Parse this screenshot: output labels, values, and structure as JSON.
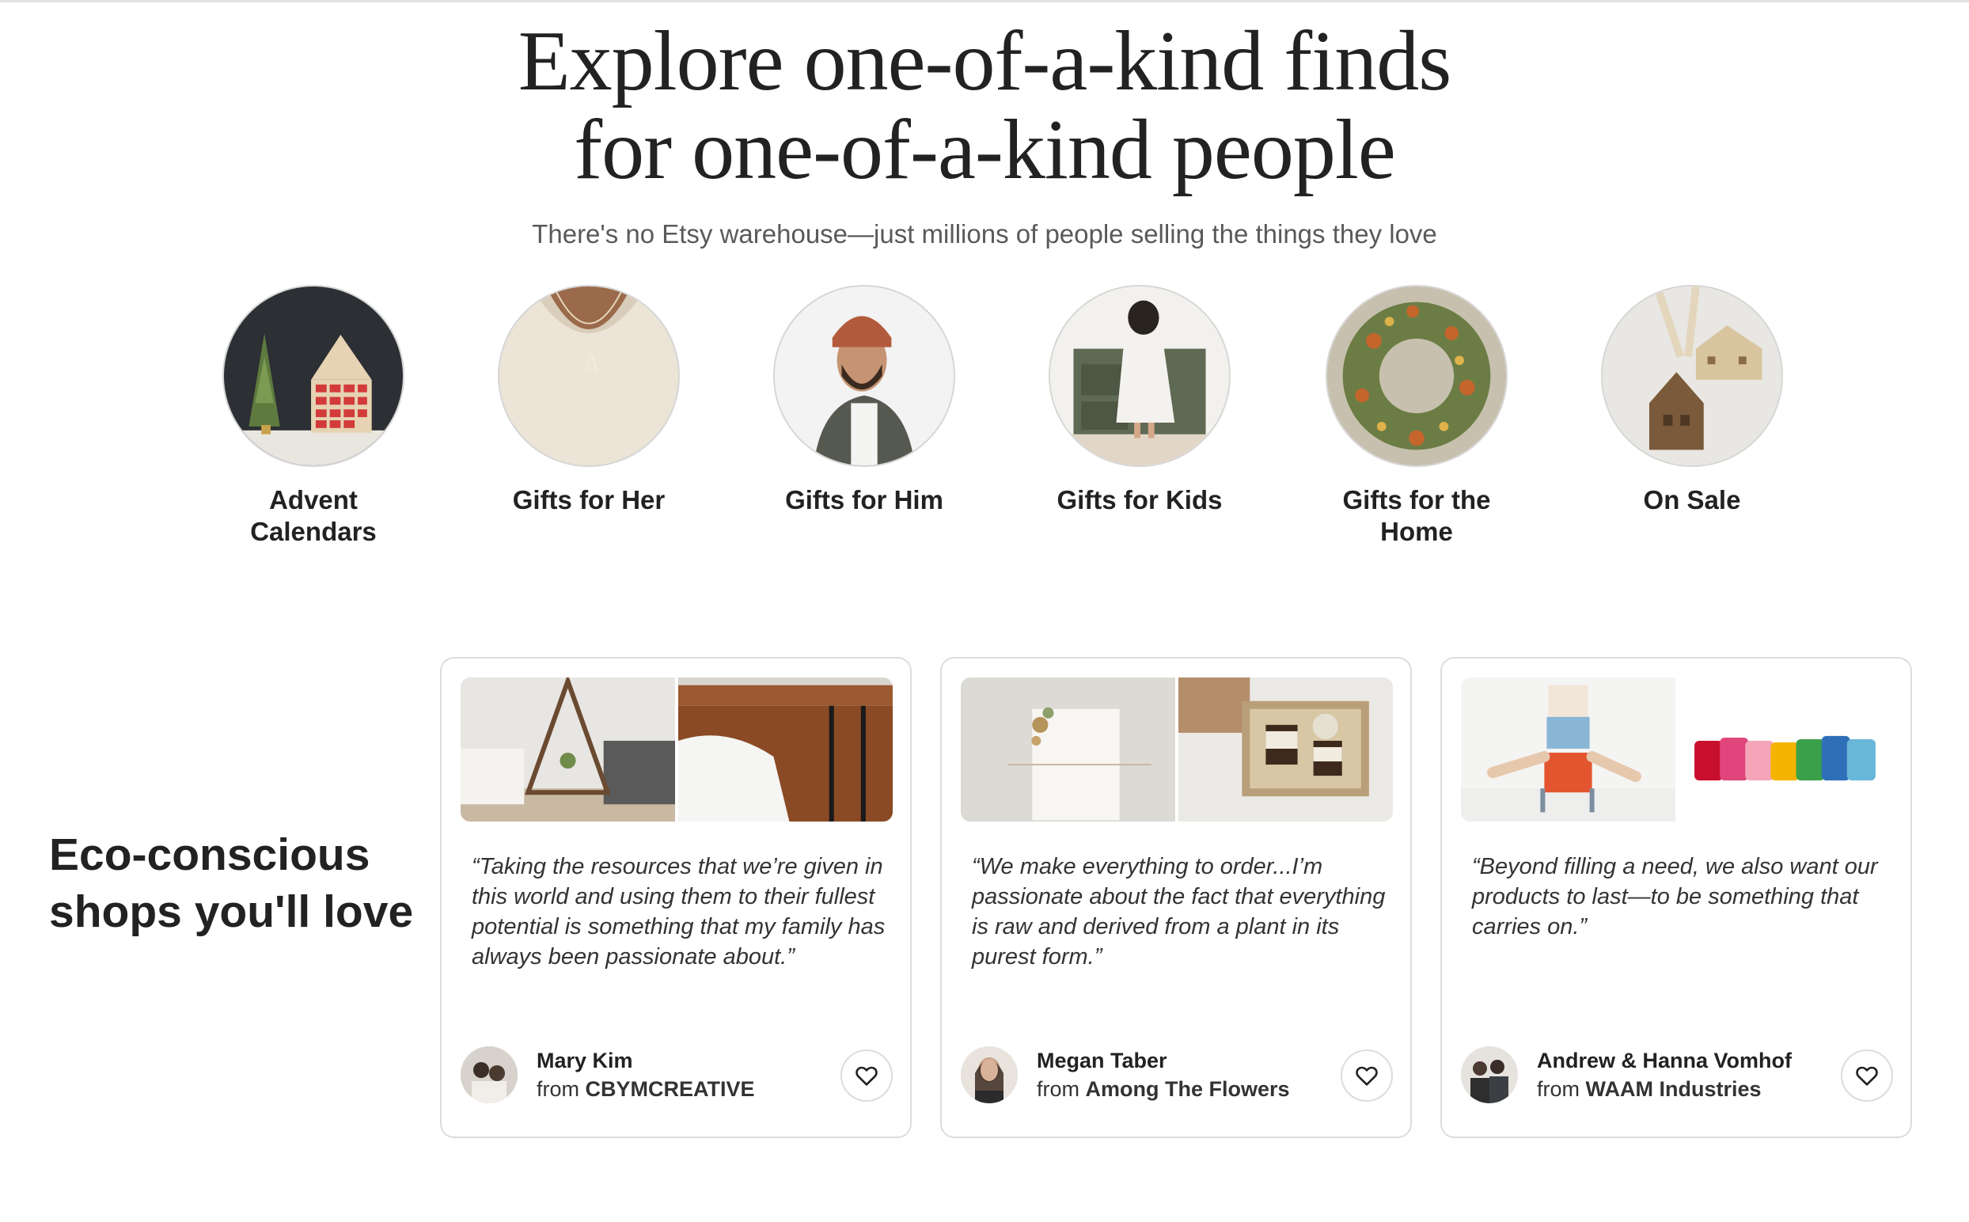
{
  "hero": {
    "title_line1": "Explore one-of-a-kind finds",
    "title_line2": "for one-of-a-kind people",
    "subtitle": "There's no Etsy warehouse—just millions of people selling the things they love"
  },
  "categories": [
    {
      "label": "Advent Calendars",
      "icon": "advent-calendar-photo"
    },
    {
      "label": "Gifts for Her",
      "icon": "necklace-photo"
    },
    {
      "label": "Gifts for Him",
      "icon": "man-beanie-photo"
    },
    {
      "label": "Gifts for Kids",
      "icon": "play-kitchen-photo"
    },
    {
      "label": "Gifts for the Home",
      "icon": "wreath-photo"
    },
    {
      "label": "On Sale",
      "icon": "house-ornament-photo"
    }
  ],
  "eco": {
    "title": "Eco-conscious shops you'll love",
    "cards": [
      {
        "quote": "“Taking the resources that we’re given in this world and using them to their fullest potential is something that my family has always been passionate about.”",
        "seller_name": "Mary Kim",
        "from_prefix": "from ",
        "shop": "CBYMCREATIVE"
      },
      {
        "quote": "“We make everything to order...I’m passionate about the fact that everything is raw and derived from a plant in its purest form.”",
        "seller_name": "Megan Taber",
        "from_prefix": "from ",
        "shop": "Among The Flowers"
      },
      {
        "quote": "“Beyond filling a need, we also want our products to last—to be something that carries on.”",
        "seller_name": "Andrew & Hanna Vomhof",
        "from_prefix": "from ",
        "shop": "WAAM Industries"
      }
    ]
  },
  "colors": {
    "text": "#222222",
    "muted": "#595959",
    "border": "#dcdcdc"
  }
}
